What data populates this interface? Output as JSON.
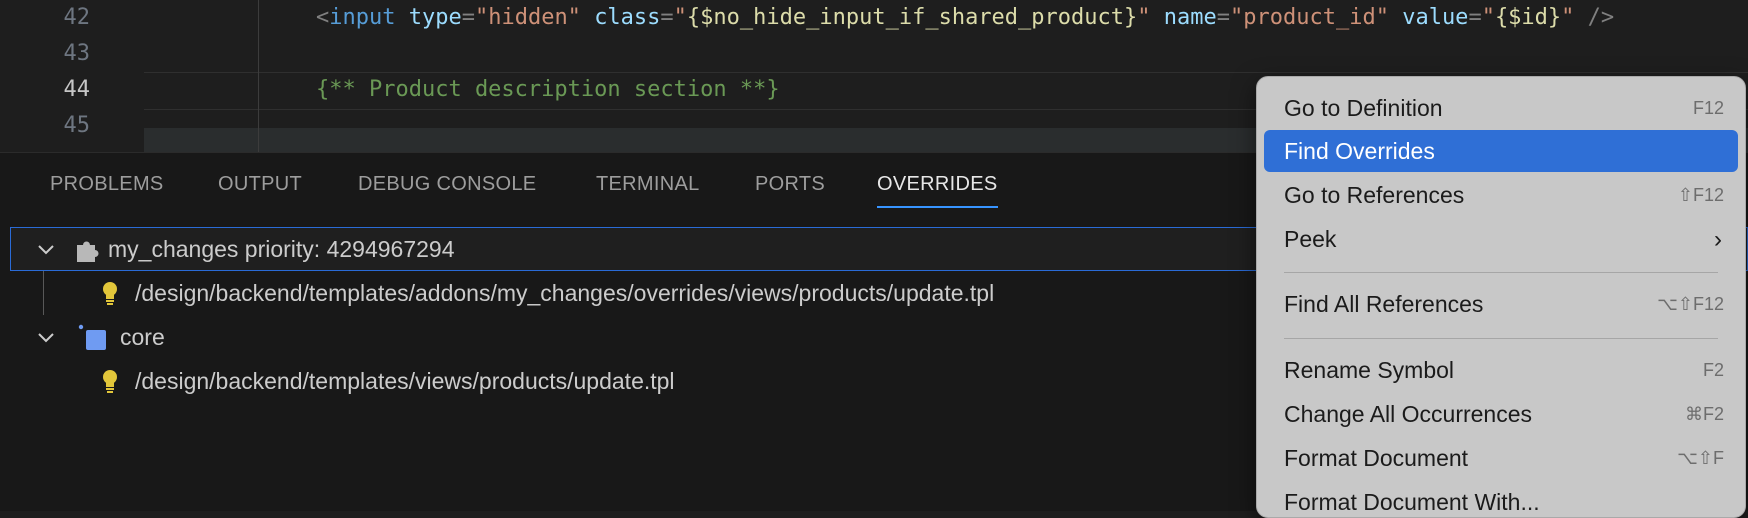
{
  "editor": {
    "line_numbers": [
      "42",
      "43",
      "44",
      "45"
    ],
    "line42": {
      "open": "<",
      "tag": "input",
      "attr_type": "type",
      "eq": "=",
      "val_type": "\"hidden\"",
      "attr_class": "class",
      "q_open": "\"",
      "var_class": "{$no_hide_input_if_shared_product}",
      "q_close": "\"",
      "attr_name": "name",
      "val_name": "\"product_id\"",
      "attr_value": "value",
      "var_id": "{$id}",
      "close": " />"
    },
    "line44_comment": "{** Product description section **}"
  },
  "panel": {
    "tabs": [
      "PROBLEMS",
      "OUTPUT",
      "DEBUG CONSOLE",
      "TERMINAL",
      "PORTS",
      "OVERRIDES"
    ],
    "active_tab": "OVERRIDES",
    "tree": [
      {
        "label": "my_changes priority: 4294967294",
        "icon": "puzzle-icon",
        "expanded": true
      },
      {
        "label": "/design/backend/templates/addons/my_changes/overrides/views/products/update.tpl",
        "icon": "lightbulb-icon"
      },
      {
        "label": "core",
        "icon": "cube-icon",
        "expanded": true
      },
      {
        "label": "/design/backend/templates/views/products/update.tpl",
        "icon": "lightbulb-icon"
      }
    ]
  },
  "context_menu": {
    "items": [
      {
        "label": "Go to Definition",
        "shortcut": "F12"
      },
      {
        "label": "Find Overrides",
        "shortcut": ""
      },
      {
        "label": "Go to References",
        "shortcut": "⇧F12"
      },
      {
        "label": "Peek",
        "shortcut": "›"
      },
      {
        "label": "Find All References",
        "shortcut": "⌥⇧F12"
      },
      {
        "label": "Rename Symbol",
        "shortcut": "F2"
      },
      {
        "label": "Change All Occurrences",
        "shortcut": "⌘F2"
      },
      {
        "label": "Format Document",
        "shortcut": "⌥⇧F"
      },
      {
        "label": "Format Document With...",
        "shortcut": ""
      }
    ]
  },
  "colors": {
    "accent": "#3794ff",
    "menu_highlight": "#2f6fd6",
    "lightbulb": "#e2c63a",
    "core_cube": "#6f9bf2"
  }
}
